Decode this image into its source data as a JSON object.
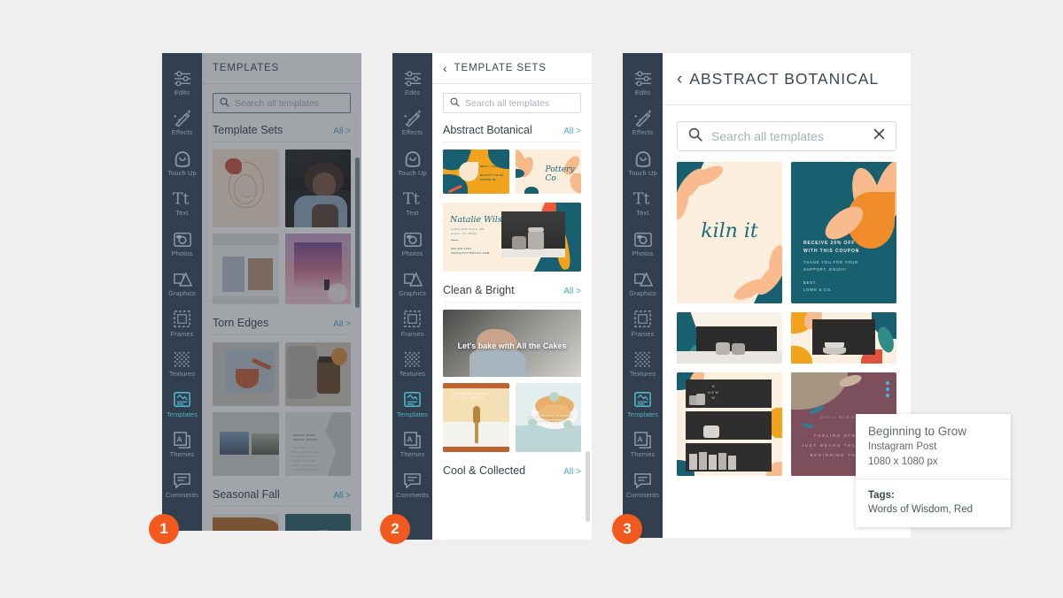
{
  "meta": {
    "bg_color": "#efefef",
    "accent_orange": "#f1591f",
    "rail_bg": "#323f4f",
    "link_blue": "#49a8c4",
    "active_teal": "#4fb4c8"
  },
  "rail": {
    "items": [
      {
        "label": "Edits",
        "icon": "sliders-icon"
      },
      {
        "label": "Effects",
        "icon": "magic-wand-icon"
      },
      {
        "label": "Touch Up",
        "icon": "face-icon"
      },
      {
        "label": "Text",
        "icon": "text-icon"
      },
      {
        "label": "Photos",
        "icon": "photos-icon"
      },
      {
        "label": "Graphics",
        "icon": "graphics-icon"
      },
      {
        "label": "Frames",
        "icon": "frames-icon"
      },
      {
        "label": "Textures",
        "icon": "textures-icon"
      },
      {
        "label": "Templates",
        "icon": "templates-icon"
      },
      {
        "label": "Themes",
        "icon": "themes-icon"
      },
      {
        "label": "Comments",
        "icon": "comments-icon"
      }
    ],
    "active_label": "Templates"
  },
  "panel1": {
    "badge": "1",
    "title": "TEMPLATES",
    "search": {
      "placeholder": "Search all templates",
      "value": ""
    },
    "sections": [
      {
        "title": "Template Sets",
        "all_label": "All >",
        "thumbs": [
          "line-art-face-cream",
          "portrait-woman-photo",
          "torn-paper-collage",
          "purple-sunset-photo"
        ]
      },
      {
        "title": "Torn Edges",
        "all_label": "All >",
        "thumbs": [
          "torn-orange-pour",
          "autumn-candle-photo",
          "torn-landscape-duo",
          "torn-travel-text"
        ]
      },
      {
        "title": "Seasonal Fall",
        "all_label": "All >",
        "thumbs": [
          "fall-portrait",
          "teal-bag-photo"
        ]
      }
    ]
  },
  "panel2": {
    "badge": "2",
    "title": "TEMPLATE SETS",
    "back_icon": "chevron-left-icon",
    "search": {
      "placeholder": "Search all templates",
      "value": ""
    },
    "sections": [
      {
        "title": "Abstract Botanical",
        "all_label": "All >",
        "thumbs": [
          "botanical-orange-card",
          "pottery-co-card",
          "natalie-wilson-card"
        ]
      },
      {
        "title": "Clean & Bright",
        "all_label": "All >",
        "thumbs": [
          "baking-hero-photo",
          "honey-dipper-photo",
          "donuts-photo"
        ]
      },
      {
        "title": "Cool & Collected",
        "all_label": "All >",
        "thumbs": []
      }
    ],
    "card_texts": {
      "pottery": "Pottery Co",
      "natalie_name": "Natalie Wilson",
      "natalie_line1": "17034 40th Street NW",
      "natalie_line2": "Austin, TX 78701",
      "natalie_line3": "806.206.1284",
      "natalie_line4": "INFO@POTTERYCO.COM",
      "baking_hero": "Let's bake with All the Cakes",
      "honey": "Getting our bake on",
      "donuts": "Life at its best is always transformation"
    }
  },
  "panel3": {
    "badge": "3",
    "title": "ABSTRACT BOTANICAL",
    "back_icon": "chevron-left-icon",
    "search": {
      "placeholder": "Search all templates",
      "value": "",
      "clear_icon": "close-icon"
    },
    "templates": [
      {
        "name": "kiln-it-card",
        "caption": "kiln it"
      },
      {
        "name": "coupon-card",
        "caption": "RECEIVE 20% OFF WITH THIS COUPON"
      },
      {
        "name": "pottery-shelf-wide",
        "caption": ""
      },
      {
        "name": "botanical-bowls-wide",
        "caption": ""
      },
      {
        "name": "new-collection-stack",
        "caption": ""
      },
      {
        "name": "beginning-to-grow-card",
        "caption": "FEELING STRANGE JUST MEANS THAT YOU'RE BEGINNING TO GROW"
      }
    ],
    "coupon_lines": [
      "RECEIVE 20% OFF",
      "WITH THIS COUPON",
      "THANK YOU FOR YOUR",
      "SUPPORT, ENJOY!",
      "BEST,",
      "LOWE & CO."
    ],
    "maroon_lines": [
      "DAILY REMINDER",
      "FEELING STRANGE",
      "JUST MEANS THAT YOU'RE",
      "BEGINNING TO GROW"
    ],
    "stack_label": "N NEW W",
    "kebab_icon": "more-options-icon"
  },
  "tooltip": {
    "title": "Beginning to Grow",
    "type": "Instagram Post",
    "dimensions": "1080 x 1080 px",
    "tags_label": "Tags:",
    "tags_value": "Words of Wisdom, Red"
  }
}
